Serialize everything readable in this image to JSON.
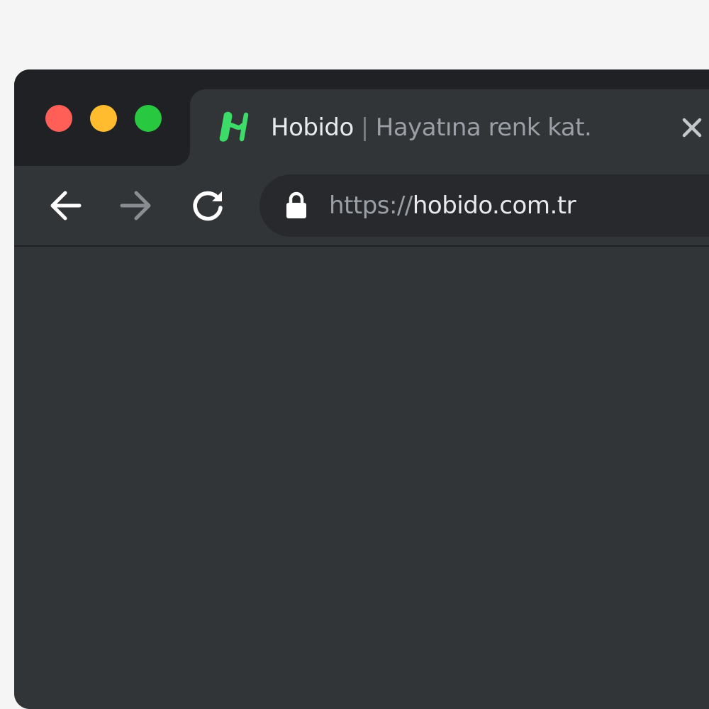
{
  "colors": {
    "page_background": "#f5f5f5",
    "window_background": "#323538",
    "tabstrip_background": "#202124",
    "omnibox_background": "#28292c",
    "close_red": "#ff5f57",
    "minimize_yellow": "#febc2e",
    "maximize_green": "#28c840",
    "brand_green": "#3ddc68"
  },
  "window_controls": {
    "close": "traffic-light-close",
    "minimize": "traffic-light-minimize",
    "maximize": "traffic-light-maximize"
  },
  "tab": {
    "favicon": "hobido-logo-icon",
    "brand": "Hobido",
    "separator": "|",
    "tagline": "Hayatına renk kat.",
    "close_icon": "close-icon"
  },
  "toolbar": {
    "back_icon": "arrow-left-icon",
    "forward_icon": "arrow-right-icon",
    "reload_icon": "reload-icon",
    "forward_enabled": false
  },
  "address_bar": {
    "lock_icon": "lock-icon",
    "scheme": "https://",
    "host": "hobido.com.tr"
  }
}
